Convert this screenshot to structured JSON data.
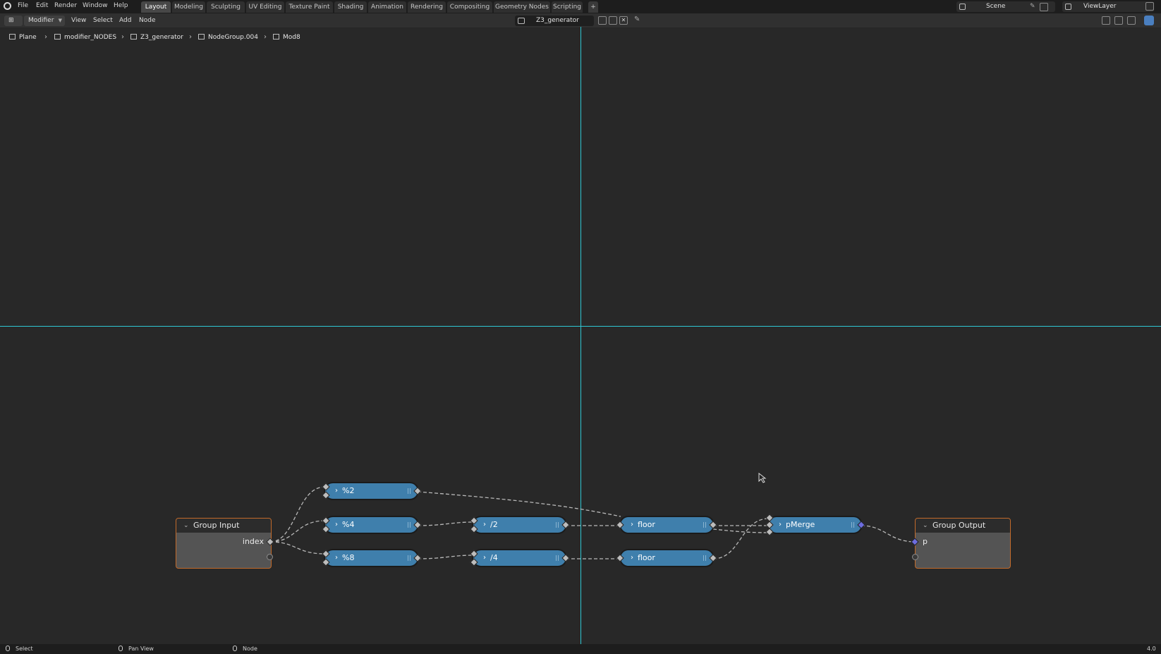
{
  "topbar": {
    "menus": [
      "File",
      "Edit",
      "Render",
      "Window",
      "Help"
    ],
    "workspaces": [
      "Layout",
      "Modeling",
      "Sculpting",
      "UV Editing",
      "Texture Paint",
      "Shading",
      "Animation",
      "Rendering",
      "Compositing",
      "Geometry Nodes",
      "Scripting"
    ],
    "active_workspace": "Layout",
    "add_tab": "+",
    "scene": "Scene",
    "view_layer": "ViewLayer"
  },
  "header": {
    "editor_mode": "Modifier",
    "menus": [
      "View",
      "Select",
      "Add",
      "Node"
    ],
    "node_group": "Z3_generator"
  },
  "breadcrumb": [
    "Plane",
    "modifier_NODES",
    "Z3_generator",
    "NodeGroup.004",
    "Mod8"
  ],
  "nodes": {
    "group_input": {
      "title": "Group Input",
      "socket": "index"
    },
    "group_output": {
      "title": "Group Output",
      "socket": "p"
    },
    "mod2": "%2",
    "mod4": "%4",
    "mod8": "%8",
    "div2": "/2",
    "div4": "/4",
    "floor_a": "floor",
    "floor_b": "floor",
    "pmerge": "pMerge"
  },
  "statusbar": {
    "select": "Select",
    "pan": "Pan View",
    "node": "Node",
    "version": "4.0"
  },
  "colors": {
    "node_blue": "#3f7fac",
    "guide_cyan": "#2fc7d4",
    "group_border": "#c26a2a",
    "background": "#282828"
  }
}
